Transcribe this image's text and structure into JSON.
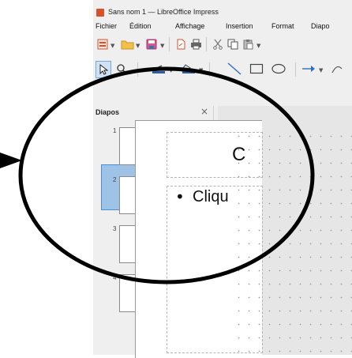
{
  "window": {
    "title": "Sans nom 1 — LibreOffice Impress"
  },
  "menubar": {
    "items": [
      "Fichier",
      "Édition",
      "Affichage",
      "Insertion",
      "Format",
      "Diapo"
    ]
  },
  "slide_panel": {
    "title": "Diapos",
    "close_glyph": "×",
    "slides": [
      {
        "number": "1",
        "selected": false
      },
      {
        "number": "2",
        "selected": false
      },
      {
        "number": "3",
        "selected": false
      },
      {
        "number": "4",
        "selected": true
      }
    ]
  },
  "slide": {
    "title_placeholder": "C",
    "content_placeholder": "Cliqu",
    "bullet": "•"
  },
  "colors": {
    "selection": "#9ec3e6",
    "annotation": "#000000",
    "app_icon": "#d3532e"
  },
  "annotation": {
    "ellipse": "black-ellipse-highlight",
    "arrow": "black-arrow-pointer"
  }
}
